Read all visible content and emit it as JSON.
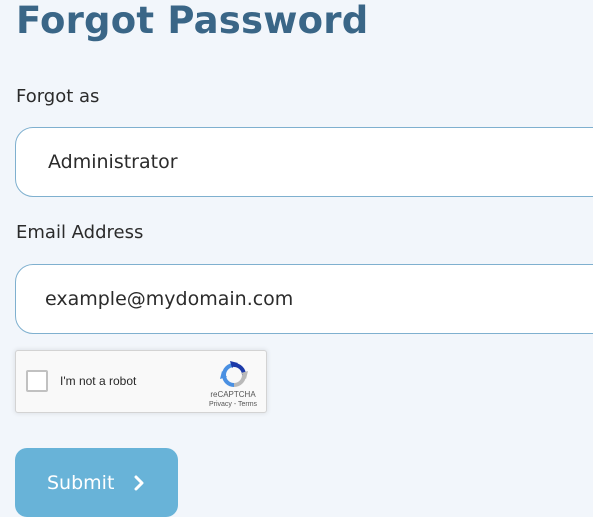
{
  "page": {
    "title": "Forgot Password"
  },
  "form": {
    "forgot_as_label": "Forgot as",
    "forgot_as_value": "Administrator",
    "email_label": "Email Address",
    "email_value": "example@mydomain.com"
  },
  "recaptcha": {
    "label": "I'm not a robot",
    "brand": "reCAPTCHA",
    "links": "Privacy - Terms",
    "checked": false
  },
  "submit": {
    "label": "Submit",
    "icon": "chevron-right-icon"
  },
  "colors": {
    "title": "#3a6687",
    "background": "#f2f6fb",
    "field_border": "#7fb0cf",
    "button": "#68b3d8"
  }
}
